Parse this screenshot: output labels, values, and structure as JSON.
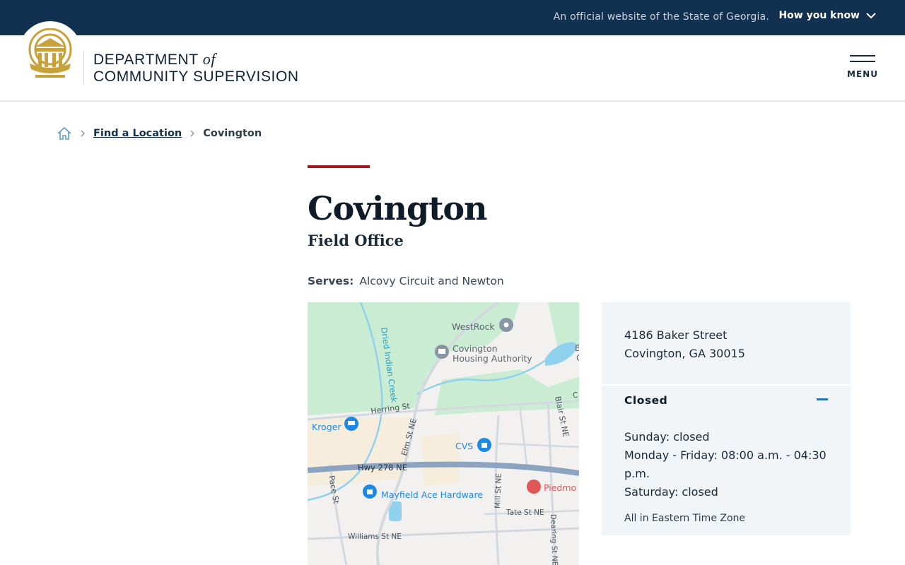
{
  "topbar": {
    "official_text": "An official website of the State of Georgia.",
    "how_you_know": "How you know"
  },
  "header": {
    "logo_line1": "DEPARTMENT",
    "logo_of": "of",
    "logo_line2": "COMMUNITY SUPERVISION",
    "menu_label": "MENU"
  },
  "breadcrumb": {
    "items": [
      "Find a Location",
      "Covington"
    ]
  },
  "page": {
    "title": "Covington",
    "subtitle": "Field Office",
    "serves_label": "Serves:",
    "serves_value": "Alcovy Circuit and Newton"
  },
  "location": {
    "address_line1": "4186 Baker Street",
    "address_line2": "Covington, GA 30015",
    "status": "Closed",
    "hours": [
      "Sunday: closed",
      "Monday - Friday: 08:00 a.m. - 04:30 p.m.",
      "Saturday: closed"
    ],
    "timezone_note": "All in Eastern Time Zone"
  },
  "map": {
    "labels": {
      "westrock": "WestRock",
      "housing1": "Covington",
      "housing2": "Housing Authority",
      "creek": "Dried Indian Creek",
      "herring": "Herring St",
      "kroger": "Kroger",
      "elm": "Elm St NE",
      "cvs": "CVS",
      "blair": "Blair St NE",
      "hwy": "Hwy 278 NE",
      "pace": "Pace St",
      "mayfield": "Mayfield Ace Hardware",
      "mill": "Mill St NE",
      "piedmont": "Piedmo",
      "tate": "Tate St NE",
      "dearing": "Dearing St NE",
      "williams": "Williams St NE",
      "edge_b": "B",
      "edge_c1": "C",
      "edge_c2": "C"
    },
    "colors": {
      "park": "#c9ecd3",
      "water": "#8fd1ee",
      "highway": "#8da4c0",
      "commercial": "#f6eddc",
      "pin_blue": "#1e88e5",
      "pin_red": "#e05757",
      "pin_gray": "#8895a2"
    }
  },
  "colors": {
    "topbar_bg": "#12304f",
    "accent_red": "#a3171e",
    "seal_gold": "#c9a13b",
    "info_bg": "#f1f5f8"
  },
  "icons": [
    "chevron-down-icon",
    "state-seal-icon",
    "hamburger-icon",
    "home-icon",
    "chevron-right-icon",
    "minus-icon"
  ]
}
